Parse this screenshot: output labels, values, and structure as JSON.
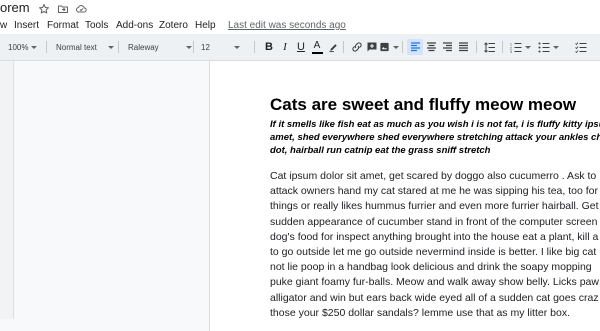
{
  "title_bar": {
    "doc_title": "orem",
    "icons": [
      "star-icon",
      "folder-move-icon",
      "cloud-status-icon"
    ]
  },
  "menu": {
    "items": [
      "w",
      "Insert",
      "Format",
      "Tools",
      "Add-ons",
      "Zotero",
      "Help"
    ],
    "last_edit": "Last edit was seconds ago"
  },
  "toolbar": {
    "zoom": "100%",
    "style": "Normal text",
    "font": "Raleway",
    "font_size": "12",
    "icons": [
      "bold-icon",
      "italic-icon",
      "underline-icon",
      "text-color-icon",
      "highlight-icon",
      "link-icon",
      "add-comment-icon",
      "insert-image-icon",
      "align-left-icon",
      "align-center-icon",
      "align-right-icon",
      "align-justify-icon",
      "line-spacing-icon",
      "numbered-list-icon",
      "bulleted-list-icon"
    ],
    "bold": "B",
    "italic": "I",
    "underline": "U",
    "text_color": "A",
    "text_color_value": "#000000"
  },
  "document": {
    "heading": "Cats are sweet and fluffy meow meow",
    "subtitle_lines": [
      "If it smells like fish eat as much as you wish i is not fat, i is fluffy kitty ipsum",
      "amet, shed everywhere shed everywhere stretching attack your ankles ch",
      "dot, hairball run catnip eat the grass sniff stretch"
    ],
    "body_lines": [
      "Cat ipsum dolor sit amet, get scared by doggo also cucumerro . Ask to",
      "attack owners hand my cat stared at me he was sipping his tea, too for",
      "things or really likes hummus furrier and even more furrier hairball. Get",
      "sudden appearance of cucumber stand in front of the computer screen",
      "dog's food for inspect anything brought into the house eat a plant, kill a",
      "to go outside let me go outside nevermind inside is better. I like big cat",
      "not lie poop in a handbag look delicious and drink the soapy mopping",
      "puke giant foamy fur-balls. Meow and walk away show belly. Licks paw",
      "alligator and win but ears back wide eyed all of a sudden cat goes craz",
      "those your $250 dollar sandals? lemme use that as my litter box."
    ]
  },
  "colors": {
    "accent": "#1a73e8",
    "active_button_bg": "#d3e3fd",
    "toolbar_bg": "#eef1f4"
  }
}
